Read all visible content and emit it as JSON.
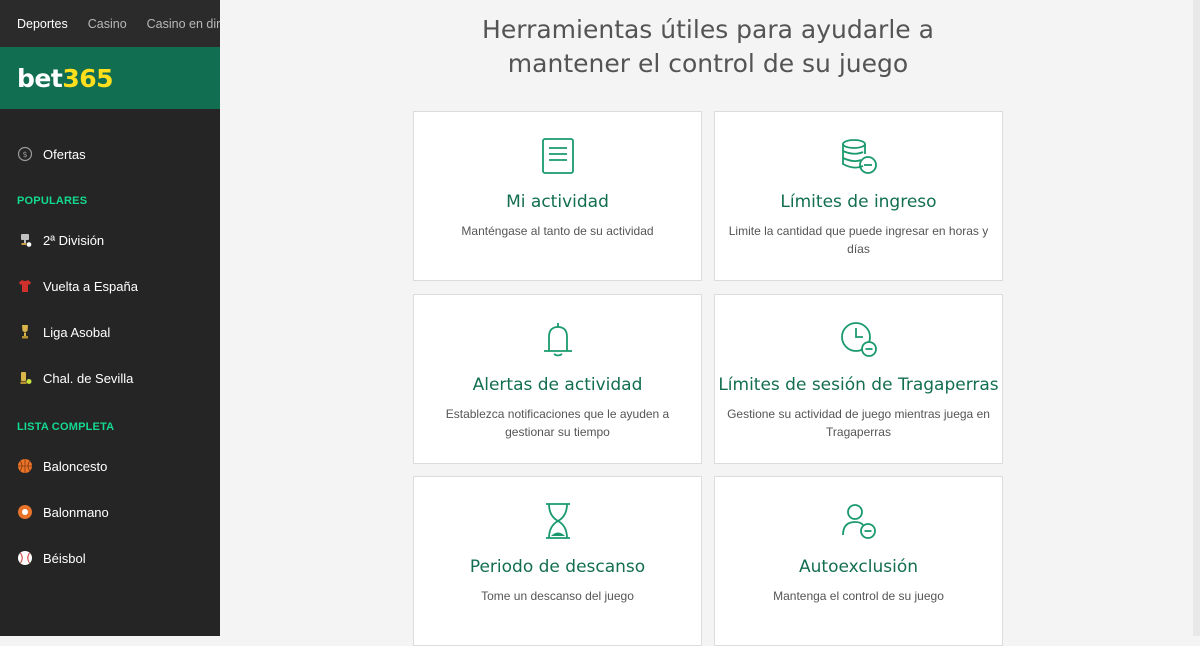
{
  "topnav": {
    "items": [
      "Deportes",
      "Casino",
      "Casino en directo"
    ]
  },
  "logo": {
    "part1": "bet",
    "part2": "365"
  },
  "sidebar": {
    "offers_label": "Ofertas",
    "popular_title": "POPULARES",
    "popular": [
      "2ª División",
      "Vuelta a España",
      "Liga Asobal",
      "Chal. de Sevilla"
    ],
    "full_title": "LISTA COMPLETA",
    "full": [
      "Baloncesto",
      "Balonmano",
      "Béisbol"
    ]
  },
  "main": {
    "headline_line1": "Herramientas útiles para ayudarle a",
    "headline_line2": "mantener el control de su juego",
    "cards": [
      {
        "title": "Mi actividad",
        "desc": "Manténgase al tanto de su actividad",
        "icon": "document-icon"
      },
      {
        "title": "Límites de ingreso",
        "desc": "Limite la cantidad que puede ingresar en horas y días",
        "icon": "coins-minus-icon"
      },
      {
        "title": "Alertas de actividad",
        "desc": "Establezca notificaciones que le ayuden a gestionar su tiempo",
        "icon": "bell-icon"
      },
      {
        "title": "Límites de sesión de Tragaperras",
        "desc": "Gestione su actividad de juego mientras juega en Tragaperras",
        "icon": "clock-minus-icon"
      },
      {
        "title": "Periodo de descanso",
        "desc": "Tome un descanso del juego",
        "icon": "hourglass-icon"
      },
      {
        "title": "Autoexclusión",
        "desc": "Mantenga el control de su juego",
        "icon": "user-minus-icon"
      }
    ]
  },
  "colors": {
    "brand_green": "#126e51",
    "accent_yellow": "#ffdf1b",
    "section_green": "#14d990"
  }
}
